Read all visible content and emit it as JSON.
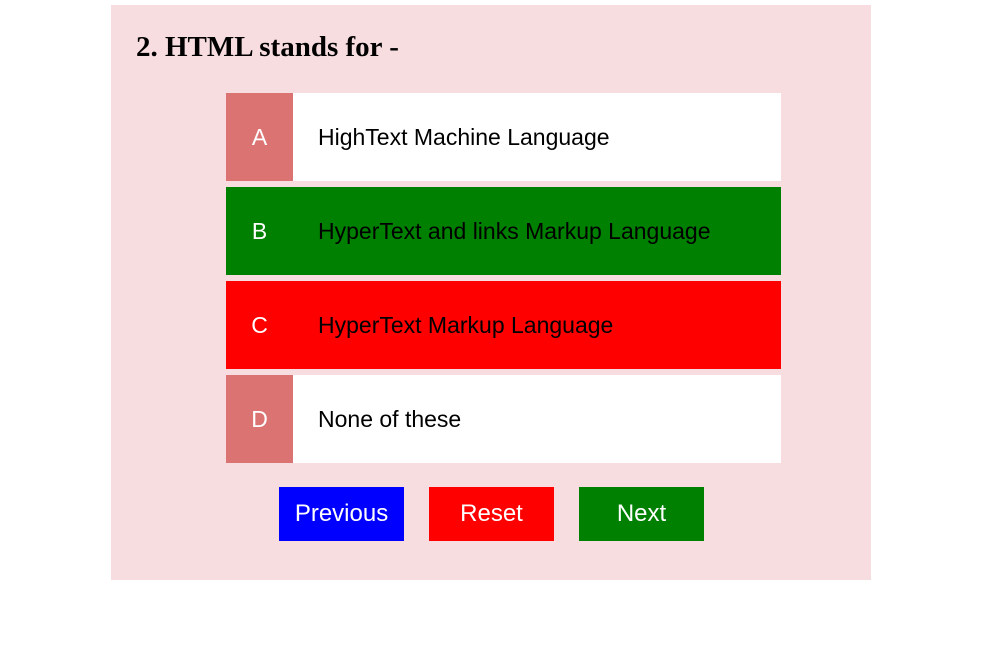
{
  "question": {
    "title": "2. HTML stands for -"
  },
  "options": [
    {
      "letter": "A",
      "text": "HighText Machine Language",
      "state": "default"
    },
    {
      "letter": "B",
      "text": "HyperText and links Markup Language",
      "state": "correct"
    },
    {
      "letter": "C",
      "text": "HyperText Markup Language",
      "state": "wrong"
    },
    {
      "letter": "D",
      "text": "None of these",
      "state": "default"
    }
  ],
  "controls": {
    "previous_label": "Previous",
    "reset_label": "Reset",
    "next_label": "Next"
  },
  "colors": {
    "panel_background": "#f8dde0",
    "letter_background": "#dc7373",
    "correct": "#008000",
    "wrong": "#ff0000",
    "previous_button": "#0000ff"
  }
}
